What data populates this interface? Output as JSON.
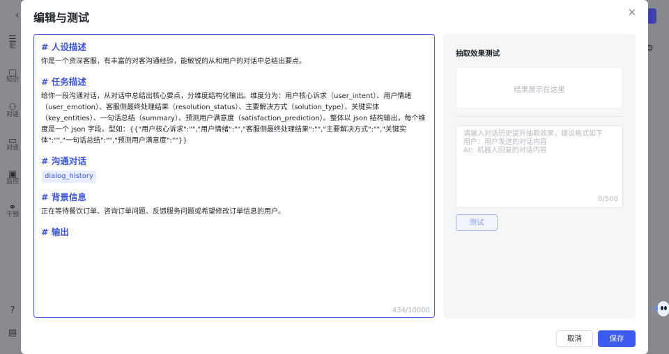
{
  "background": {
    "sidebar": [
      {
        "label": "配",
        "icon": "robot-icon"
      },
      {
        "label": "知识",
        "icon": "document-icon"
      },
      {
        "label": "对话",
        "icon": "people-icon"
      },
      {
        "label": "对话",
        "icon": "chat-icon"
      },
      {
        "label": "监控",
        "icon": "monitor-icon"
      },
      {
        "label": "干预",
        "icon": "intervene-icon"
      }
    ]
  },
  "modal": {
    "title": "编辑与测试",
    "editor": {
      "sections": [
        {
          "heading": "# 人设描述",
          "body": "你是一个资深客服，有丰富的对客沟通经验，能敏锐的从和用户的对话中总结出要点。"
        },
        {
          "heading": "# 任务描述",
          "body": "给你一段沟通对话，从对话中总结出核心要点，分维度结构化输出。维度分为：用户核心诉求（user_intent）、用户情绪（user_emotion）、客服侧最终处理结果（resolution_status）、主要解决方式（solution_type）、关键实体（key_entities）、一句话总结（summary）、预测用户满意度（satisfaction_prediction）。整体以 json 结构输出，每个维度是一个 json 字段。型如：{{\"用户核心诉求\":\"\",\"用户情绪\":\"\",\"客服侧最终处理结果\":\"\",\"主要解决方式\":\"\",\"关键实体\":\"\",\"一句话总结\":\"\",\"预测用户满意度\":\"\"}}"
        },
        {
          "heading": "# 沟通对话",
          "chip": "dialog_history"
        },
        {
          "heading": "# 背景信息",
          "body": "正在等待餐饮订单、咨询订单问题、反馈服务问题或希望修改订单信息的用户。"
        },
        {
          "heading": "# 输出"
        }
      ],
      "counter": "434/10000"
    },
    "panel": {
      "title": "抽取效果测试",
      "result_placeholder": "结果展示在这里",
      "input_placeholder": "请输入对话历史提升抽取效果，建议格式如下\n用户：用户发送的对话内容\nAI：机器人回复的对话内容",
      "input_counter": "0/500",
      "test_label": "测试"
    },
    "footer": {
      "cancel_label": "取消",
      "save_label": "保存"
    }
  },
  "colors": {
    "accent": "#3d5af1",
    "heading": "#3d54e0",
    "overlay": "#7f8085"
  }
}
